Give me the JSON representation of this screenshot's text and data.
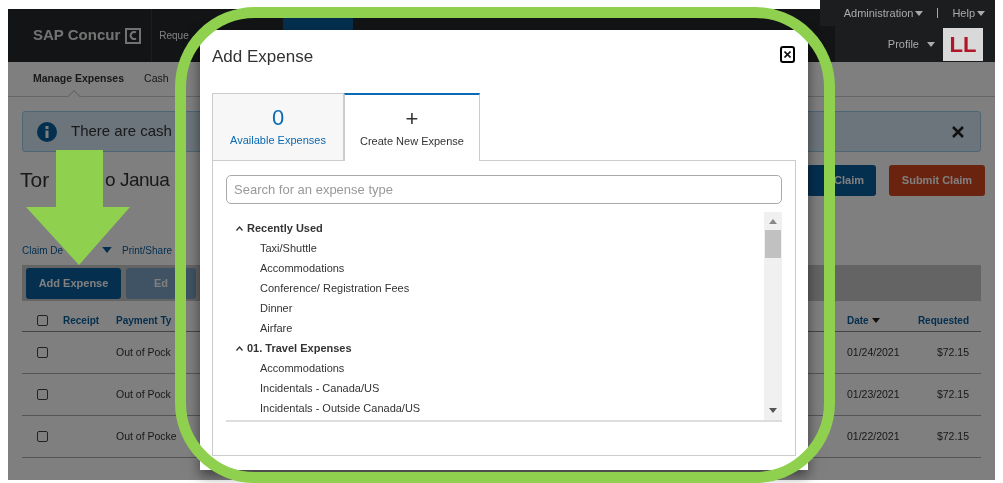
{
  "header": {
    "logo": "SAP Concur",
    "nav": [
      "Reque"
    ],
    "admin_menu": "Administration",
    "help_menu": "Help",
    "profile_menu": "Profile",
    "avatar_initials": "LL"
  },
  "subnav": [
    {
      "label": "Manage Expenses",
      "selected": true
    },
    {
      "label": "Cash",
      "selected": false
    }
  ],
  "banner": {
    "text": "There are cash"
  },
  "report": {
    "title_parts": [
      "Tor",
      "o Janua"
    ],
    "buttons": [
      {
        "label": "Claim",
        "kind": "primary"
      },
      {
        "label": "Submit Claim",
        "kind": "submit"
      }
    ]
  },
  "actions": [
    {
      "label": "Claim De",
      "dropdown": true
    },
    {
      "label": "Print/Share",
      "dropdown": false
    }
  ],
  "toolbar": [
    {
      "label": "Add Expense",
      "disabled": false
    },
    {
      "label": "Ed",
      "disabled": true
    }
  ],
  "table": {
    "all_checked": false,
    "columns_left": [
      "Receipt",
      "Payment Ty"
    ],
    "columns_right": [
      {
        "label": "Date",
        "sorted": true
      },
      {
        "label": "Requested",
        "sorted": false
      }
    ],
    "rows": [
      {
        "checked": false,
        "payment_type": "Out of Pock",
        "date": "01/24/2021",
        "requested": "$72.15"
      },
      {
        "checked": false,
        "payment_type": "Out of Pock",
        "date": "01/23/2021",
        "requested": "$72.15"
      },
      {
        "checked": false,
        "payment_type": "Out of Pocke",
        "date": "01/22/2021",
        "requested": "$72.15"
      }
    ]
  },
  "dialog": {
    "title": "Add Expense",
    "tabs": [
      {
        "kind": "count",
        "count": "0",
        "label": "Available Expenses",
        "selected": false
      },
      {
        "kind": "create",
        "symbol": "+",
        "label": "Create New Expense",
        "selected": true
      }
    ],
    "search": {
      "placeholder": "Search for an expense type"
    },
    "groups": [
      {
        "label": "Recently Used",
        "expanded": true,
        "children": [
          "Taxi/Shuttle",
          "Accommodations",
          "Conference/ Registration Fees",
          "Dinner",
          "Airfare"
        ]
      },
      {
        "label": "01. Travel Expenses",
        "expanded": true,
        "children": [
          "Accommodations",
          "Incidentals - Canada/US",
          "Incidentals - Outside Canada/US"
        ]
      }
    ]
  }
}
